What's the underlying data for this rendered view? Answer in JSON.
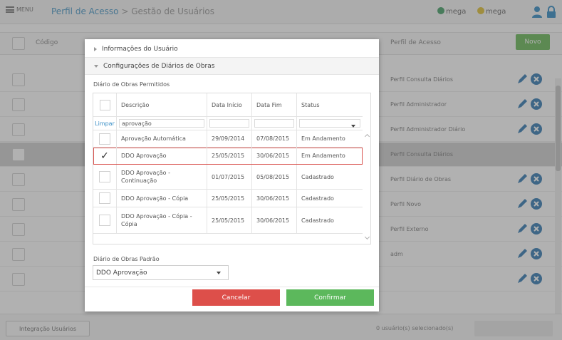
{
  "app": {
    "menu_label": "MENU",
    "breadcrumb": {
      "section": "Perfil de Acesso",
      "separator": ">",
      "current": "Gestão de Usuários"
    },
    "logos": [
      "mega",
      "mega"
    ]
  },
  "background_table": {
    "columns": {
      "codigo": "Código",
      "perfil": "Perfil de Acesso"
    },
    "new_button": "Novo",
    "rows": [
      {
        "perfil": "Perfil Consulta Diários",
        "actions": true,
        "selected": false
      },
      {
        "perfil": "Perfil Administrador",
        "actions": true,
        "selected": false
      },
      {
        "perfil": "Perfil Administrador Diário",
        "actions": true,
        "selected": false
      },
      {
        "perfil": "Perfil Consulta Diários",
        "actions": false,
        "selected": true
      },
      {
        "perfil": "Perfil Diário de Obras",
        "actions": true,
        "selected": false
      },
      {
        "perfil": "Perfil Novo",
        "actions": true,
        "selected": false
      },
      {
        "perfil": "Perfil Externo",
        "actions": true,
        "selected": false
      },
      {
        "perfil": "adm",
        "actions": true,
        "selected": false
      },
      {
        "perfil": "",
        "actions": true,
        "selected": false
      }
    ]
  },
  "bottom_bar": {
    "integration_button": "Integração Usuários",
    "selection_status": "0 usuário(s) selecionado(s)"
  },
  "modal": {
    "section_user_info": "Informações do Usuário",
    "section_config": "Configurações de Diários de Obras",
    "grid_title": "Diário de Obras Permitidos",
    "grid": {
      "headers": {
        "descricao": "Descrição",
        "data_inicio": "Data Início",
        "data_fim": "Data Fim",
        "status": "Status"
      },
      "filter": {
        "clear": "Limpar",
        "descricao": "aprovação",
        "data_inicio": "",
        "data_fim": "",
        "status": ""
      },
      "rows": [
        {
          "checked": false,
          "descricao": "Aprovação Automática",
          "data_inicio": "29/09/2014",
          "data_fim": "07/08/2015",
          "status": "Em Andamento"
        },
        {
          "checked": true,
          "descricao": "DDO Aprovação",
          "data_inicio": "25/05/2015",
          "data_fim": "30/06/2015",
          "status": "Em Andamento"
        },
        {
          "checked": false,
          "descricao": "DDO Aprovação - Continuação",
          "data_inicio": "01/07/2015",
          "data_fim": "05/08/2015",
          "status": "Cadastrado"
        },
        {
          "checked": false,
          "descricao": "DDO Aprovação - Cópia",
          "data_inicio": "25/05/2015",
          "data_fim": "30/06/2015",
          "status": "Cadastrado"
        },
        {
          "checked": false,
          "descricao": "DDO Aprovação - Cópia - Cópia",
          "data_inicio": "25/05/2015",
          "data_fim": "30/06/2015",
          "status": "Cadastrado"
        }
      ]
    },
    "default_label": "Diário de Obras Padrão",
    "default_value": "DDO Aprovação",
    "cancel_label": "Cancelar",
    "confirm_label": "Confirmar"
  },
  "colors": {
    "link": "#4c9ac9",
    "cancel": "#dd4f4a",
    "confirm": "#5cb85c",
    "new_button": "#6dbb5c",
    "selected_row_border": "#d9534f",
    "action_icon": "#3a7fb5"
  }
}
